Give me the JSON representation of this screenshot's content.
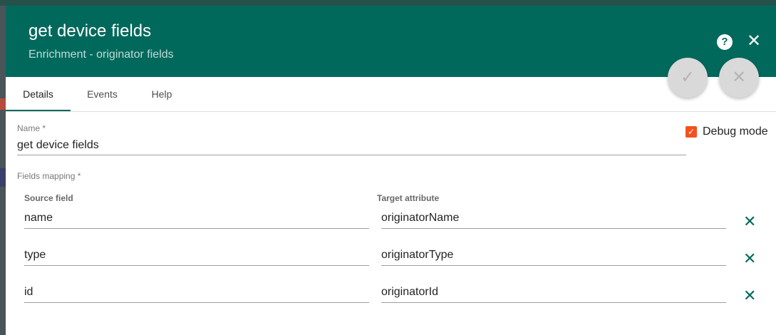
{
  "dialog": {
    "title": "get device fields",
    "subtitle": "Enrichment - originator fields"
  },
  "header_actions": {
    "help_icon": "help-circle-icon",
    "help_glyph": "?",
    "close_icon": "close-icon",
    "close_glyph": "✕"
  },
  "fabs": {
    "apply_icon": "check-icon",
    "apply_glyph": "✓",
    "cancel_icon": "close-icon",
    "cancel_glyph": "✕"
  },
  "tabs": [
    {
      "label": "Details",
      "active": true
    },
    {
      "label": "Events",
      "active": false
    },
    {
      "label": "Help",
      "active": false
    }
  ],
  "form": {
    "name_label": "Name *",
    "name_value": "get device fields",
    "debug_label": "Debug mode",
    "debug_checked": true,
    "checkbox_glyph": "✓",
    "fields_mapping_label": "Fields mapping *",
    "source_header": "Source field",
    "target_header": "Target attribute",
    "delete_glyph": "✕",
    "rows": [
      {
        "source": "name",
        "target": "originatorName"
      },
      {
        "source": "type",
        "target": "originatorType"
      },
      {
        "source": "id",
        "target": "originatorId"
      }
    ]
  },
  "colors": {
    "header_bg": "#00695c",
    "checkbox": "#f4511e",
    "delete_icon": "#00695c"
  }
}
